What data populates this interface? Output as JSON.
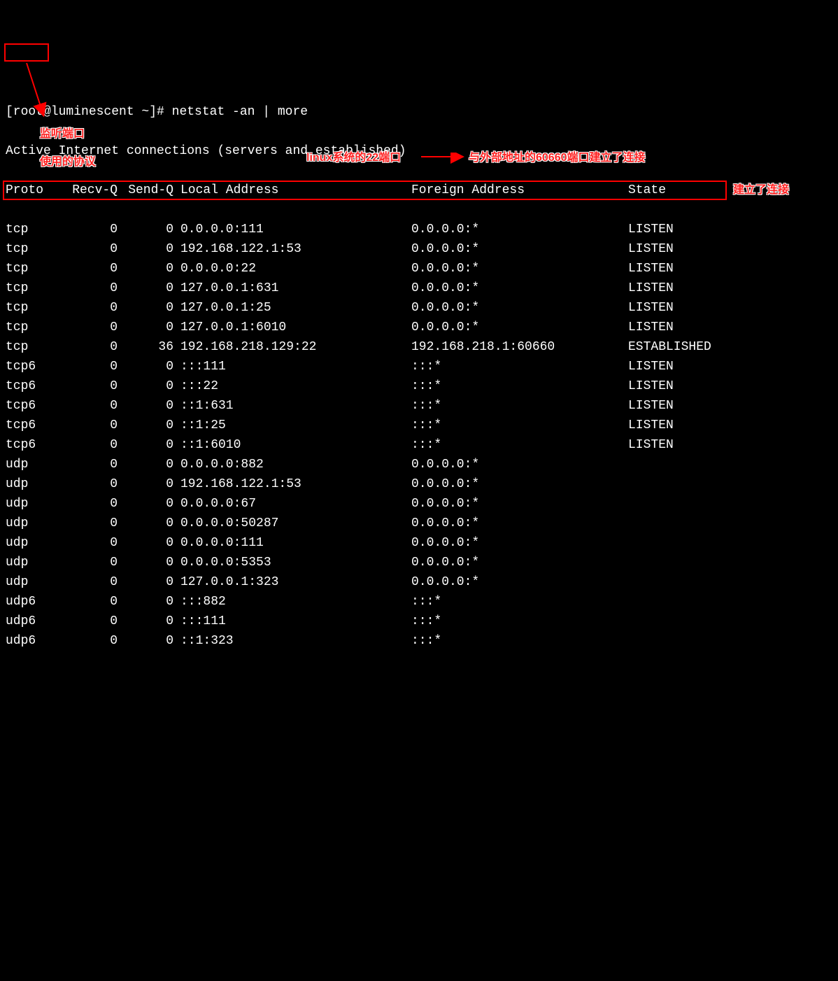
{
  "prompt": "[root@luminescent ~]# netstat -an | more",
  "title": "Active Internet connections (servers and established)",
  "headers": {
    "proto": "Proto",
    "recvq": "Recv-Q",
    "sendq": "Send-Q",
    "local": "Local Address",
    "foreign": "Foreign Address",
    "state": "State"
  },
  "rows": [
    {
      "proto": "tcp",
      "recvq": "0",
      "sendq": "0",
      "local": "0.0.0.0:111",
      "foreign": "0.0.0.0:*",
      "state": "LISTEN"
    },
    {
      "proto": "tcp",
      "recvq": "0",
      "sendq": "0",
      "local": "192.168.122.1:53",
      "foreign": "0.0.0.0:*",
      "state": "LISTEN"
    },
    {
      "proto": "tcp",
      "recvq": "0",
      "sendq": "0",
      "local": "0.0.0.0:22",
      "foreign": "0.0.0.0:*",
      "state": "LISTEN"
    },
    {
      "proto": "tcp",
      "recvq": "0",
      "sendq": "0",
      "local": "127.0.0.1:631",
      "foreign": "0.0.0.0:*",
      "state": "LISTEN"
    },
    {
      "proto": "tcp",
      "recvq": "0",
      "sendq": "0",
      "local": "127.0.0.1:25",
      "foreign": "0.0.0.0:*",
      "state": "LISTEN"
    },
    {
      "proto": "tcp",
      "recvq": "0",
      "sendq": "0",
      "local": "127.0.0.1:6010",
      "foreign": "0.0.0.0:*",
      "state": "LISTEN"
    },
    {
      "proto": "tcp",
      "recvq": "0",
      "sendq": "36",
      "local": "192.168.218.129:22",
      "foreign": "192.168.218.1:60660",
      "state": "ESTABLISHED"
    },
    {
      "proto": "tcp6",
      "recvq": "0",
      "sendq": "0",
      "local": ":::111",
      "foreign": ":::*",
      "state": "LISTEN"
    },
    {
      "proto": "tcp6",
      "recvq": "0",
      "sendq": "0",
      "local": ":::22",
      "foreign": ":::*",
      "state": "LISTEN"
    },
    {
      "proto": "tcp6",
      "recvq": "0",
      "sendq": "0",
      "local": "::1:631",
      "foreign": ":::*",
      "state": "LISTEN"
    },
    {
      "proto": "tcp6",
      "recvq": "0",
      "sendq": "0",
      "local": "::1:25",
      "foreign": ":::*",
      "state": "LISTEN"
    },
    {
      "proto": "tcp6",
      "recvq": "0",
      "sendq": "0",
      "local": "::1:6010",
      "foreign": ":::*",
      "state": "LISTEN"
    },
    {
      "proto": "udp",
      "recvq": "0",
      "sendq": "0",
      "local": "0.0.0.0:882",
      "foreign": "0.0.0.0:*",
      "state": ""
    },
    {
      "proto": "udp",
      "recvq": "0",
      "sendq": "0",
      "local": "192.168.122.1:53",
      "foreign": "0.0.0.0:*",
      "state": ""
    },
    {
      "proto": "udp",
      "recvq": "0",
      "sendq": "0",
      "local": "0.0.0.0:67",
      "foreign": "0.0.0.0:*",
      "state": ""
    },
    {
      "proto": "udp",
      "recvq": "0",
      "sendq": "0",
      "local": "0.0.0.0:50287",
      "foreign": "0.0.0.0:*",
      "state": ""
    },
    {
      "proto": "udp",
      "recvq": "0",
      "sendq": "0",
      "local": "0.0.0.0:111",
      "foreign": "0.0.0.0:*",
      "state": ""
    },
    {
      "proto": "udp",
      "recvq": "0",
      "sendq": "0",
      "local": "0.0.0.0:5353",
      "foreign": "0.0.0.0:*",
      "state": ""
    },
    {
      "proto": "udp",
      "recvq": "0",
      "sendq": "0",
      "local": "127.0.0.1:323",
      "foreign": "0.0.0.0:*",
      "state": ""
    },
    {
      "proto": "udp6",
      "recvq": "0",
      "sendq": "0",
      "local": ":::882",
      "foreign": ":::*",
      "state": ""
    },
    {
      "proto": "udp6",
      "recvq": "0",
      "sendq": "0",
      "local": ":::111",
      "foreign": ":::*",
      "state": ""
    },
    {
      "proto": "udp6",
      "recvq": "0",
      "sendq": "0",
      "local": "::1:323",
      "foreign": ":::*",
      "state": ""
    }
  ],
  "annotations": {
    "proto_label_line1": "监听端口",
    "proto_label_line2": "使用的协议",
    "port22_label": "linux系统的22端口",
    "foreign_port_label": "与外部地址的60660端口建立了连接",
    "established_label": "建立了连接"
  }
}
